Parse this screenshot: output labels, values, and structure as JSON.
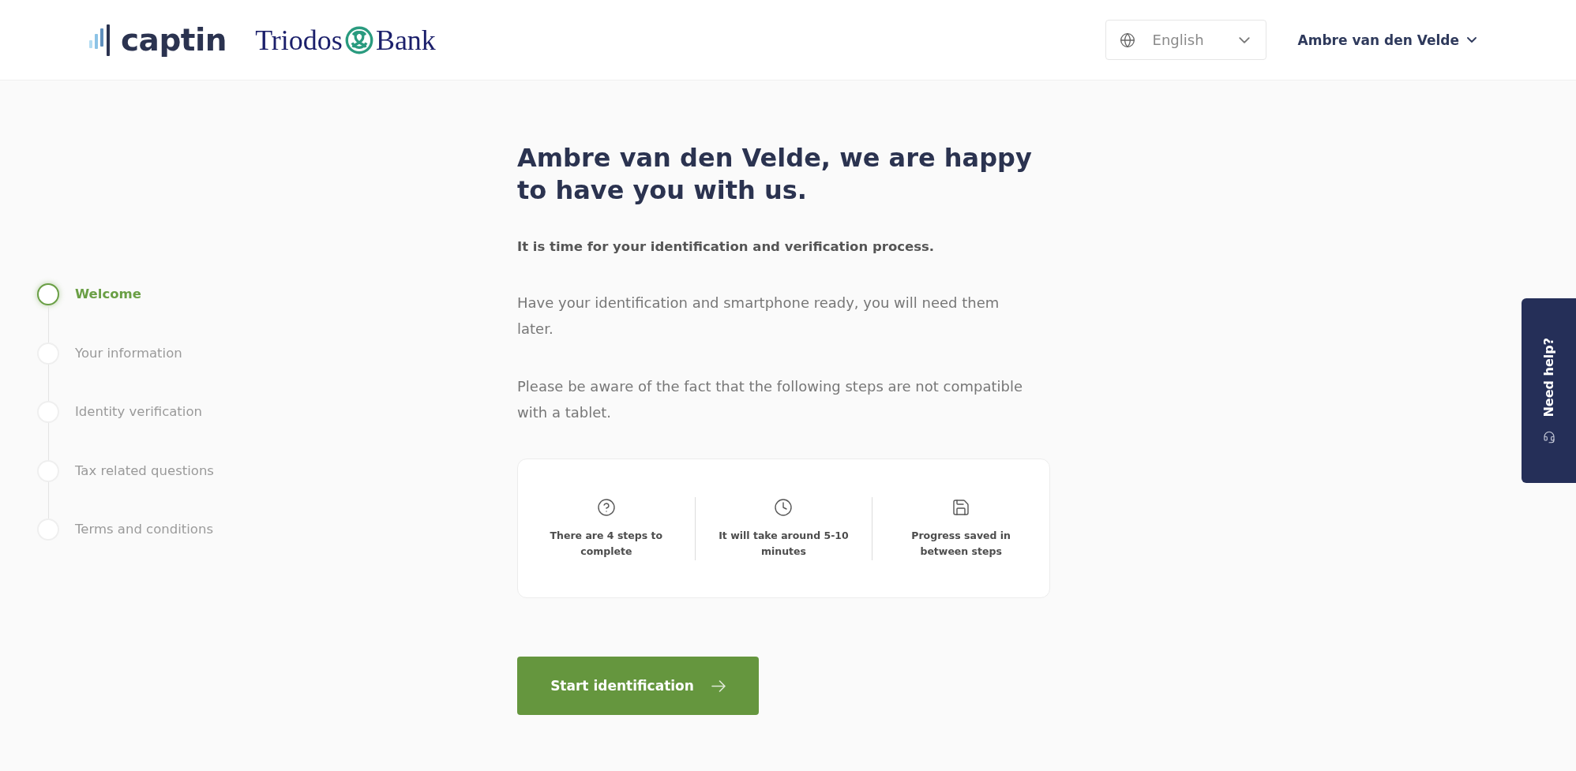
{
  "header": {
    "brand": {
      "wordmark": "captin"
    },
    "partner": {
      "word_left": "Triodos",
      "word_right": "Bank"
    },
    "language_select": {
      "value": "English"
    },
    "user_menu": {
      "label": "Ambre van den Velde"
    }
  },
  "steps": [
    {
      "label": "Welcome",
      "selected": true
    },
    {
      "label": "Your information",
      "selected": false
    },
    {
      "label": "Identity verification",
      "selected": false
    },
    {
      "label": "Tax related questions",
      "selected": false
    },
    {
      "label": "Terms and conditions",
      "selected": false
    }
  ],
  "content": {
    "title": "Ambre van den Velde, we are happy to have you with us.",
    "lead": "It is time for your identification and verification process.",
    "paragraphs": [
      "Have your identification and smartphone ready, you will need them later.",
      "Please be aware of the fact that the following steps are not compatible with a tablet."
    ],
    "facts": [
      {
        "kind": "steps",
        "text": "There are 4 steps to complete"
      },
      {
        "kind": "duration",
        "text": "It will take around 5-10 minutes"
      },
      {
        "kind": "saving",
        "text": "Progress saved in between steps"
      }
    ],
    "start_button": {
      "label": "Start identification"
    }
  },
  "help_tab": {
    "label": "Need help?"
  }
}
